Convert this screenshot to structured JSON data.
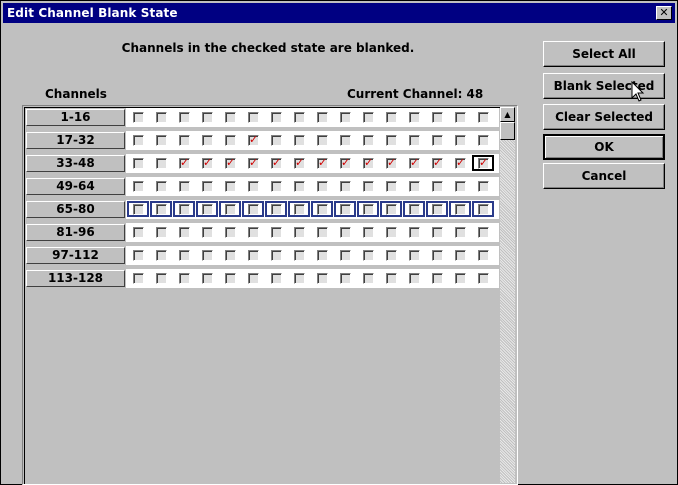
{
  "window": {
    "title": "Edit Channel Blank State",
    "close_label": "✕"
  },
  "message": "Channels in the checked state are blanked.",
  "labels": {
    "channels": "Channels",
    "current_channel": "Current Channel:  48"
  },
  "buttons": {
    "select_all": "Select All",
    "blank_selected": "Blank Selected",
    "clear_selected": "Clear Selected",
    "ok": "OK",
    "cancel": "Cancel"
  },
  "grid": {
    "current_channel": 48,
    "selected_row": "65-80",
    "rows": [
      {
        "label": "1-16",
        "checked": []
      },
      {
        "label": "17-32",
        "checked": [
          22
        ]
      },
      {
        "label": "33-48",
        "checked": [
          35,
          36,
          37,
          38,
          39,
          40,
          41,
          42,
          43,
          44,
          45,
          46,
          47,
          48
        ]
      },
      {
        "label": "49-64",
        "checked": []
      },
      {
        "label": "65-80",
        "checked": []
      },
      {
        "label": "81-96",
        "checked": []
      },
      {
        "label": "97-112",
        "checked": []
      },
      {
        "label": "113-128",
        "checked": []
      }
    ]
  }
}
